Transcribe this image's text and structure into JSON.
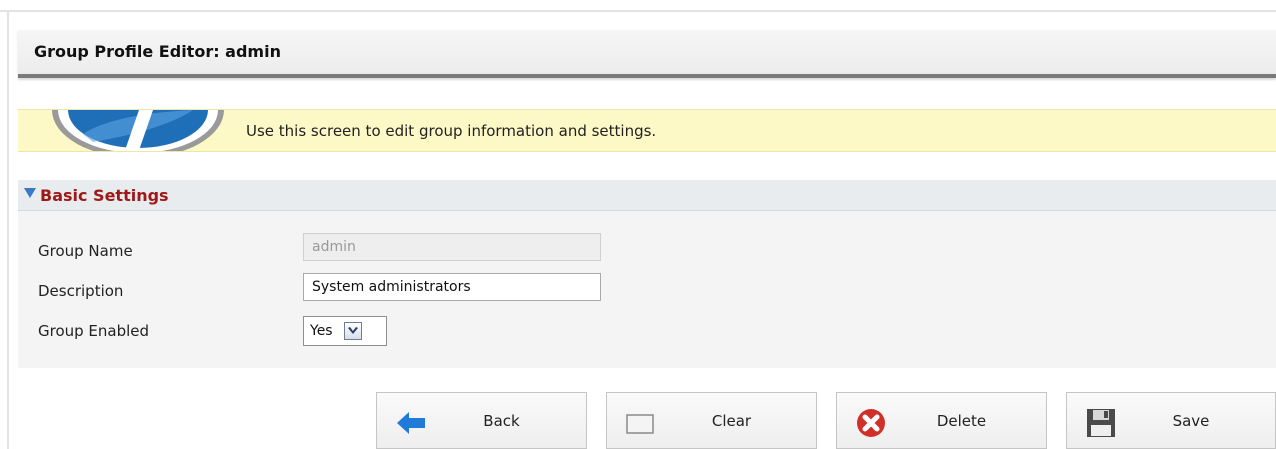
{
  "header": {
    "title": "Group Profile Editor: admin"
  },
  "banner": {
    "message": "Use this screen to edit group information and settings."
  },
  "section": {
    "title": "Basic Settings",
    "fields": {
      "group_name": {
        "label": "Group Name",
        "value": "admin"
      },
      "description": {
        "label": "Description",
        "value": "System administrators"
      },
      "group_enabled": {
        "label": "Group Enabled",
        "value": "Yes"
      }
    }
  },
  "buttons": {
    "back": "Back",
    "clear": "Clear",
    "delete": "Delete",
    "save": "Save"
  },
  "colors": {
    "section_title": "#a01919",
    "banner_bg": "#fcf9c7",
    "accent_blue": "#3a78c8",
    "delete_red": "#d0302a"
  },
  "icons": {
    "banner": "info-logo-icon",
    "back": "arrow-left-icon",
    "clear": "blank-page-icon",
    "delete": "delete-x-icon",
    "save": "floppy-disk-icon",
    "section_toggle": "triangle-down-icon"
  }
}
